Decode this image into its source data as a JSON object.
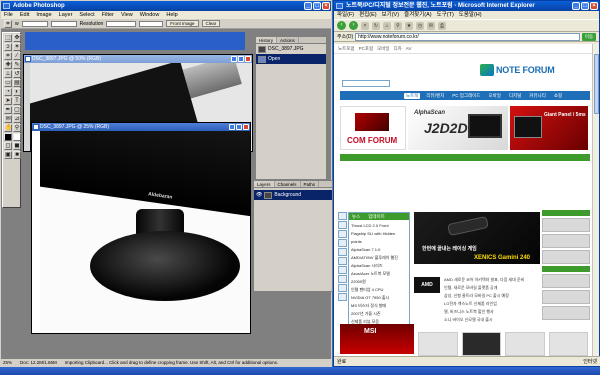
{
  "photoshop": {
    "title": "Adobe Photoshop",
    "menu": [
      "File",
      "Edit",
      "Image",
      "Layer",
      "Select",
      "Filter",
      "View",
      "Window",
      "Help"
    ],
    "options": {
      "field1_label": "w",
      "field2_label": "Resolution",
      "front_image": "Front Image",
      "clear": "Clear"
    },
    "doc_back_title": "DSC_3897.JPG @ 50% (RGB)",
    "doc_front_title": "DSC_3897.JPG @ 25% (RGB)",
    "photo_logo": "Aldebaran",
    "history": {
      "tabs": [
        "History",
        "Actions"
      ],
      "doc": "DSC_3897.JPG",
      "state": "Open"
    },
    "layers": {
      "tabs": [
        "Layers",
        "Channels",
        "Paths"
      ],
      "layer": "Background"
    },
    "status": {
      "zoom": "25%",
      "doc": "Doc: 12.2M/1.66M",
      "hint": "Importing Clipboard... Click and drag to define cropping frame. Use Shift, Alt, and Ctrl for additional options."
    }
  },
  "ie": {
    "title": "노트북/PC/디지털 정보전문 웹진, 노트포럼 - Microsoft Internet Explorer",
    "menu": [
      "파일(F)",
      "편집(E)",
      "보기(V)",
      "즐겨찾기(A)",
      "도구(T)",
      "도움말(H)"
    ],
    "address_label": "주소(D)",
    "address": "http://www.noteforum.co.kr/",
    "go": "이동",
    "status_left": "완료",
    "status_right": "인터넷"
  },
  "site": {
    "logo": "NOTE FORUM",
    "top_links": [
      "노트포럼",
      "PC포럼",
      "모바일",
      "디카",
      "AV"
    ],
    "tabs": [
      "노트북",
      "리뷰/벤치",
      "PC 업그레이드",
      "모바일",
      "디지털",
      "커뮤니티",
      "쇼핑"
    ],
    "banner_com": "COM FORUM",
    "banner_alpha_brand": "AlphaScan",
    "banner_alpha_model": "J2D2DS",
    "banner_red_text": "Giant Panel / 5ms",
    "news_tabs": [
      "뉴스",
      "업데이트"
    ],
    "news_items": [
      "Thrust LCD 2.0 Front",
      "Flagship SLI with Hidden",
      "points",
      "AlphaScan 7 1:0",
      "AMD/ATI/NV 블루레이 웹진",
      "AlphaScan 시리즈",
      "Asus/Acer 노트북 모델",
      "22000원",
      "인텔 펜티엄 4 CPU",
      "NVIDIA GT 7950 출시",
      "MS 비스타 정식 발매",
      "2007년 가을 시즌",
      "신제품 리뷰 모음"
    ],
    "feature_caption": "한번에 끝내는 레이싱 게임",
    "feature_product": "XENICS Gamini 240",
    "list_items": [
      "AMD 새로운 코어 아키텍처 발표, 다음 세대 준비",
      "인텔, 새로운 모바일 플랫폼 공개",
      "삼성, 신형 울트라 모바일 PC 출시 예정",
      "LG전자 엑스노트 신제품 라인업",
      "델, 비즈니스 노트북 할인 행사",
      "소니 바이오 신모델 국내 출시"
    ],
    "amd_label": "AMD",
    "msi": "MSI"
  }
}
